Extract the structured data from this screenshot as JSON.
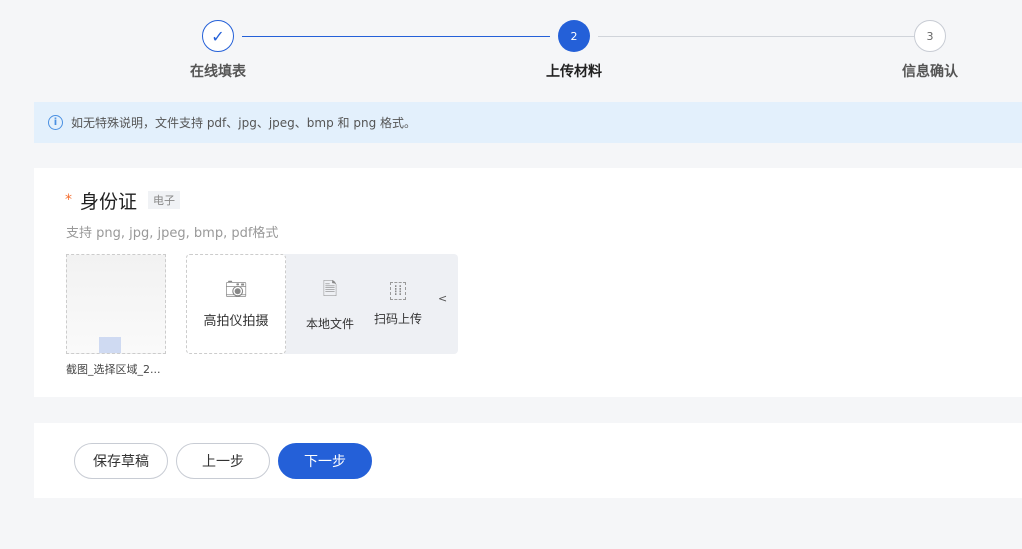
{
  "steps": [
    {
      "label": "在线填表",
      "state": "done",
      "icon": "check-icon"
    },
    {
      "label": "上传材料",
      "number": "2",
      "state": "active"
    },
    {
      "label": "信息确认",
      "number": "3",
      "state": "pending"
    }
  ],
  "notice": {
    "icon": "info-icon",
    "text": "如无特殊说明，文件支持 pdf、jpg、jpeg、bmp 和 png 格式。"
  },
  "upload": {
    "required_mark": "*",
    "title": "身份证",
    "tag": "电子",
    "hint": "支持 png, jpg, jpeg, bmp, pdf格式",
    "file_name": "截图_选择区域_2...",
    "camera_label": "高拍仪拍摄",
    "local_label": "本地文件",
    "scan_label": "扫码上传",
    "collapse": "<"
  },
  "buttons": {
    "save": "保存草稿",
    "prev": "上一步",
    "next": "下一步"
  },
  "colors": {
    "primary": "#2460d8",
    "notice_bg": "#e3f0fc"
  }
}
